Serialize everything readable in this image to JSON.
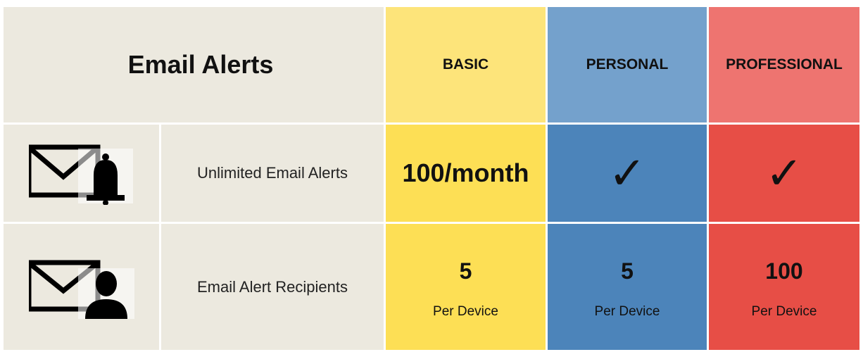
{
  "header": {
    "title": "Email Alerts",
    "plans": [
      "BASIC",
      "PERSONAL",
      "PROFESSIONAL"
    ]
  },
  "rows": [
    {
      "icon": "envelope-bell-icon",
      "label": "Unlimited Email Alerts",
      "basic": "100/month",
      "personal": "✓",
      "professional": "✓"
    },
    {
      "icon": "envelope-person-icon",
      "label": "Email Alert Recipients",
      "basic": {
        "value": "5",
        "unit": "Per Device"
      },
      "personal": {
        "value": "5",
        "unit": "Per Device"
      },
      "professional": {
        "value": "100",
        "unit": "Per Device"
      }
    }
  ],
  "colors": {
    "neutral": "#ece9df",
    "basic_header": "#fde47a",
    "basic": "#fddf55",
    "personal_header": "#74a1cc",
    "personal": "#4c84ba",
    "professional_header": "#ee7470",
    "professional": "#e74e46"
  }
}
